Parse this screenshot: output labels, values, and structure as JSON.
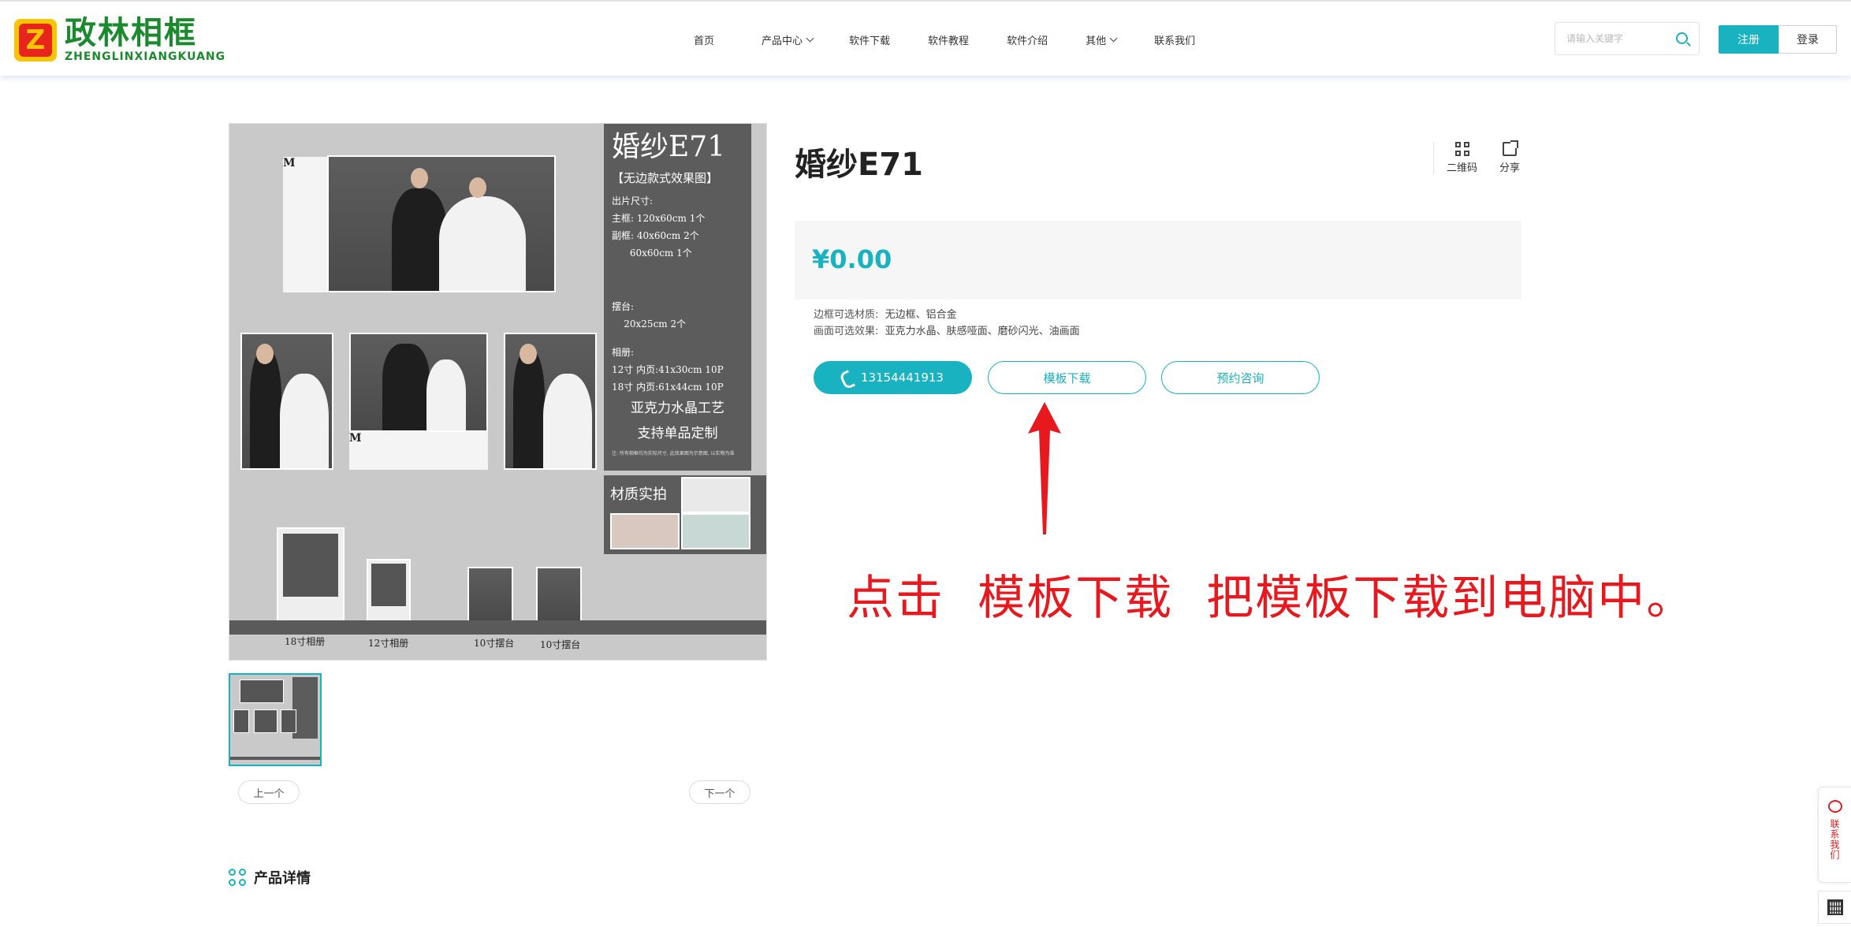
{
  "header": {
    "logo_cn": "政林相框",
    "logo_en": "ZHENGLINXIANGKUANG",
    "logo_mark": "Z",
    "nav": [
      {
        "label": "首页",
        "dropdown": false
      },
      {
        "label": "产品中心",
        "dropdown": true
      },
      {
        "label": "软件下载",
        "dropdown": false
      },
      {
        "label": "软件教程",
        "dropdown": false
      },
      {
        "label": "软件介绍",
        "dropdown": false
      },
      {
        "label": "其他",
        "dropdown": true
      },
      {
        "label": "联系我们",
        "dropdown": false
      }
    ],
    "search_placeholder": "请输入关键字",
    "register": "注册",
    "login": "登录"
  },
  "image": {
    "panel_title": "婚纱E71",
    "panel_sub": "【无边款式效果图】",
    "lines": [
      "出片尺寸:",
      "主框: 120x60cm 1个",
      "副框: 40x60cm 2个",
      "      60x60cm 1个",
      "摆台:",
      "    20x25cm 2个",
      "相册:",
      "12寸 内页:41x30cm 10P",
      "18寸 内页:61x44cm 10P"
    ],
    "big_1": "亚克力水晶工艺",
    "big_2": "支持单品定制",
    "foot": "注: 所有相框均为实际尺寸, 此效果图为示意图, 以实物为准",
    "material_title": "材质实拍",
    "labels": [
      "18寸相册",
      "12寸相册",
      "10寸摆台",
      "10寸摆台"
    ]
  },
  "pager": {
    "prev": "上一个",
    "next": "下一个"
  },
  "product": {
    "title": "婚纱E71",
    "qr_label": "二维码",
    "share_label": "分享",
    "price": "¥0.00",
    "attr_1_key": "边框可选材质:",
    "attr_1_val": "无边框、铝合金",
    "attr_2_key": "画面可选效果:",
    "attr_2_val": "亚克力水晶、肤感哑面、磨砂闪光、油画面",
    "phone": "13154441913",
    "download": "模板下载",
    "consult": "预约咨询"
  },
  "annotation": "点击  模板下载  把模板下载到电脑中。",
  "detail_title": "产品详情",
  "float_contact": "联系我们",
  "colors": {
    "accent": "#19b2c1",
    "annotation": "#e8181f",
    "logo_green": "#1b8a2e"
  }
}
